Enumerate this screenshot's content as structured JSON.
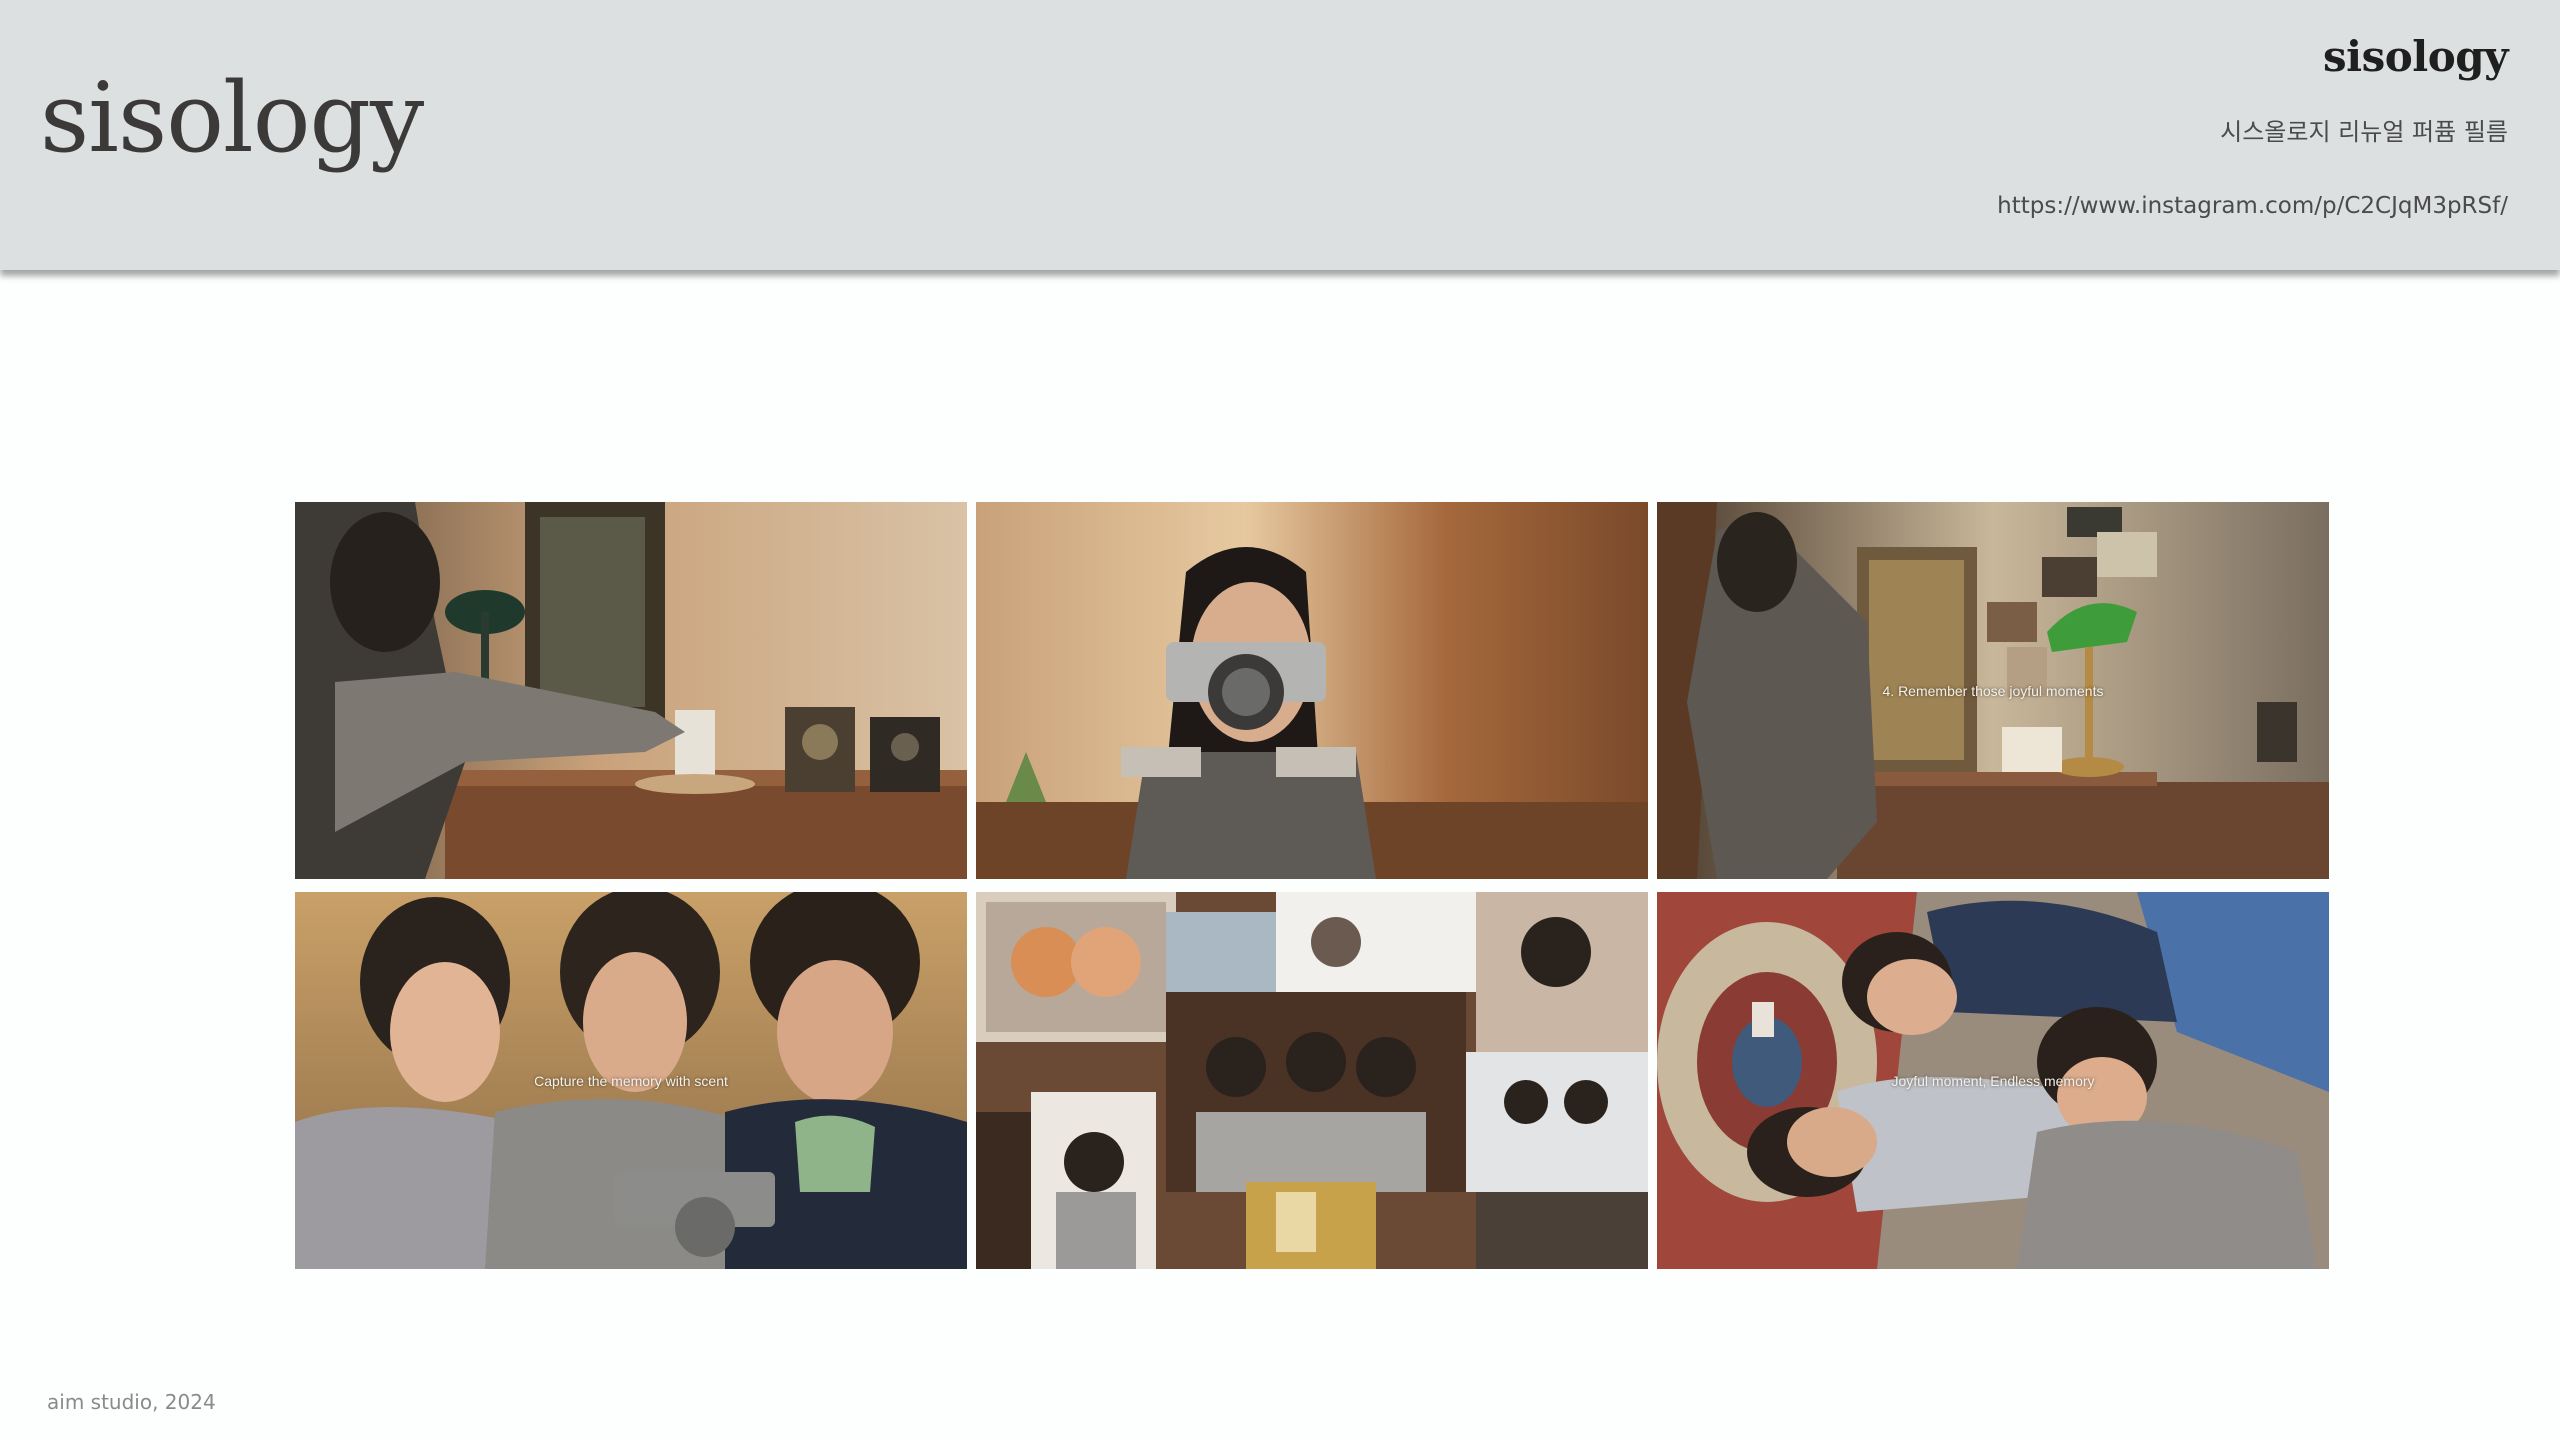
{
  "header": {
    "logo_text": "sisology",
    "brand_name": "sisology",
    "subtitle": "시스올로지 리뉴얼 퍼퓸 필름",
    "url": "https://www.instagram.com/p/C2CJqM3pRSf/"
  },
  "gallery": {
    "tiles": [
      {
        "caption": ""
      },
      {
        "caption": ""
      },
      {
        "caption": "4. Remember those joyful moments"
      },
      {
        "caption": "Capture the memory with scent"
      },
      {
        "caption": ""
      },
      {
        "caption": "Joyful moment, Endless memory"
      }
    ]
  },
  "footer": {
    "credit": "aim studio,  2024"
  },
  "colors": {
    "header_bg": "#dde0e1",
    "page_bg": "#fdfefe",
    "text_dark": "#3b3a38"
  }
}
